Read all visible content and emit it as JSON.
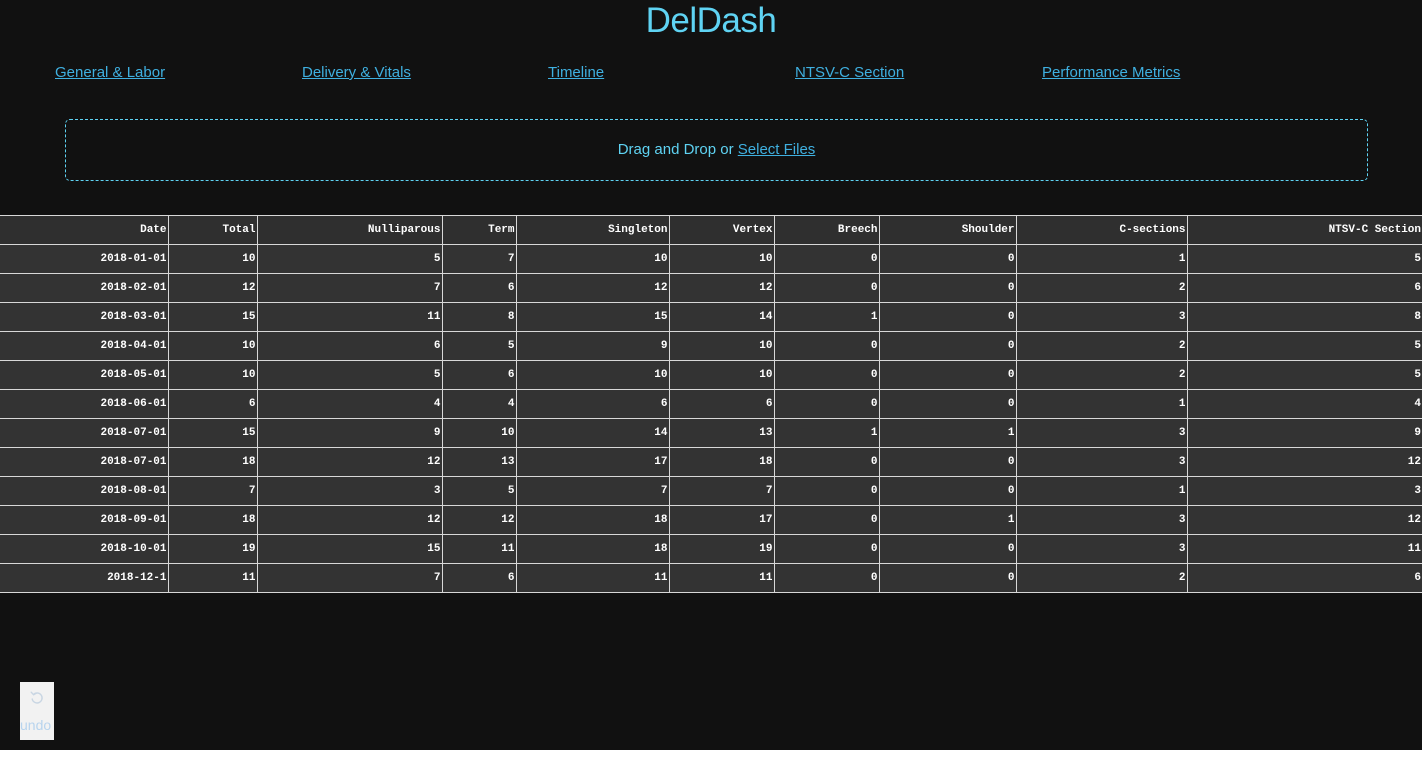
{
  "app": {
    "title": "DelDash"
  },
  "nav": {
    "items": [
      {
        "label": "General & Labor"
      },
      {
        "label": "Delivery & Vitals"
      },
      {
        "label": "Timeline"
      },
      {
        "label": "NTSV-C Section"
      },
      {
        "label": "Performance Metrics"
      }
    ]
  },
  "upload": {
    "prompt": "Drag and Drop or ",
    "link_label": "Select Files"
  },
  "table": {
    "columns": [
      "Date",
      "Total",
      "Nulliparous",
      "Term",
      "Singleton",
      "Vertex",
      "Breech",
      "Shoulder",
      "C-sections",
      "NTSV-C Section"
    ],
    "rows": [
      [
        "2018-01-01",
        "10",
        "5",
        "7",
        "10",
        "10",
        "0",
        "0",
        "1",
        "5"
      ],
      [
        "2018-02-01",
        "12",
        "7",
        "6",
        "12",
        "12",
        "0",
        "0",
        "2",
        "6"
      ],
      [
        "2018-03-01",
        "15",
        "11",
        "8",
        "15",
        "14",
        "1",
        "0",
        "3",
        "8"
      ],
      [
        "2018-04-01",
        "10",
        "6",
        "5",
        "9",
        "10",
        "0",
        "0",
        "2",
        "5"
      ],
      [
        "2018-05-01",
        "10",
        "5",
        "6",
        "10",
        "10",
        "0",
        "0",
        "2",
        "5"
      ],
      [
        "2018-06-01",
        "6",
        "4",
        "4",
        "6",
        "6",
        "0",
        "0",
        "1",
        "4"
      ],
      [
        "2018-07-01",
        "15",
        "9",
        "10",
        "14",
        "13",
        "1",
        "1",
        "3",
        "9"
      ],
      [
        "2018-07-01",
        "18",
        "12",
        "13",
        "17",
        "18",
        "0",
        "0",
        "3",
        "12"
      ],
      [
        "2018-08-01",
        "7",
        "3",
        "5",
        "7",
        "7",
        "0",
        "0",
        "1",
        "3"
      ],
      [
        "2018-09-01",
        "18",
        "12",
        "12",
        "18",
        "17",
        "0",
        "1",
        "3",
        "12"
      ],
      [
        "2018-10-01",
        "19",
        "15",
        "11",
        "18",
        "19",
        "0",
        "0",
        "3",
        "11"
      ],
      [
        "2018-12-1",
        "11",
        "7",
        "6",
        "11",
        "11",
        "0",
        "0",
        "2",
        "6"
      ]
    ]
  },
  "undo": {
    "label": "undo",
    "icon": "undo-icon"
  },
  "colors": {
    "background": "#111111",
    "accent": "#5fd3f3",
    "link": "#3fb0e0",
    "table_header_bg": "#2f2f2f",
    "table_cell_bg": "#333333"
  }
}
